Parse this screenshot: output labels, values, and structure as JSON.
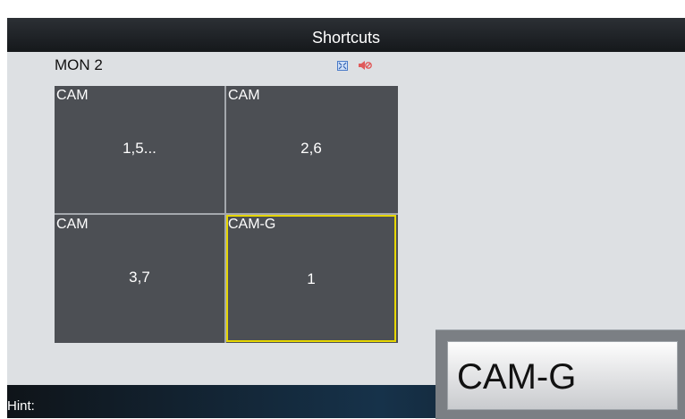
{
  "title": "Shortcuts",
  "monitor": {
    "label": "MON 2"
  },
  "icons": {
    "fullscreen": "fullscreen-icon",
    "mute": "mute-icon"
  },
  "cells": [
    {
      "label": "CAM",
      "value": "1,5..."
    },
    {
      "label": "CAM",
      "value": "2,6"
    },
    {
      "label": "CAM",
      "value": "3,7"
    },
    {
      "label": "CAM-G",
      "value": "1"
    }
  ],
  "hint": {
    "label": "Hint:"
  },
  "popup": {
    "label": "CAM-G"
  },
  "colors": {
    "selected_border": "#e6d600",
    "cell_bg": "#4c4f54",
    "screen_bg": "#dde0e3"
  }
}
